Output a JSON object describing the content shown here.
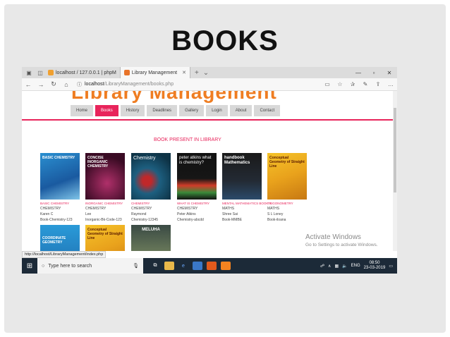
{
  "slide": {
    "title": "BOOKS"
  },
  "browser": {
    "tabs": [
      {
        "label": "localhost / 127.0.0.1 | phpM",
        "active": false
      },
      {
        "label": "Library Management",
        "active": true
      }
    ],
    "address": {
      "host": "localhost",
      "path": "/LibraryManagement/books.php"
    }
  },
  "site": {
    "banner": "Library Management",
    "menu": [
      "Home",
      "Books",
      "History",
      "Deadlines",
      "Gallery",
      "Login",
      "About",
      "Contact"
    ],
    "active_menu": "Books",
    "heading": "BOOK PRESENT IN LIBRARY"
  },
  "books": [
    {
      "cover": "BASIC CHEMISTRY",
      "tag": "BASIC CHEMISTRY",
      "subject": "CHEMISTRY",
      "author": "Karen C",
      "code": "Book-Chemistry-123"
    },
    {
      "cover": "CONCISE INORGANIC CHEMISTRY",
      "tag": "INORGANIC CHEMISTRY",
      "subject": "CHEMISTRY",
      "author": "Lee",
      "code": "Inorganic-Bk-Code-123"
    },
    {
      "cover": "Chemistry",
      "tag": "CHEMISTRY",
      "subject": "CHEMISTRY",
      "author": "Raymond",
      "code": "Chemistry-12345"
    },
    {
      "cover": "peter atkins what is chemistry?",
      "tag": "WHAT IS CHEMISTRY",
      "subject": "CHEMISTRY",
      "author": "Peter Atkins",
      "code": "Chemistry-abcdd"
    },
    {
      "cover": "handbook Mathematics",
      "tag": "MENTAL MATHEMATICS BOOK II",
      "subject": "MATHS",
      "author": "Shree Sai",
      "code": "Book-MMBE"
    },
    {
      "cover": "Conceptual Geometry of Straight Line",
      "tag": "TRIGONOMETRY",
      "subject": "MATHS",
      "author": "S L Loney",
      "code": "Book-iloana"
    },
    {
      "cover": "COORDINATE GEOMETRY",
      "tag": "",
      "subject": "",
      "author": "",
      "code": ""
    },
    {
      "cover": "Conceptual Geometry of Straight Line",
      "tag": "",
      "subject": "",
      "author": "",
      "code": ""
    },
    {
      "cover": "MELUHA",
      "tag": "",
      "subject": "",
      "author": "",
      "code": ""
    }
  ],
  "activation": {
    "title": "Activate Windows",
    "subtitle": "Go to Settings to activate Windows."
  },
  "status_url": "http://localhost/LibraryManagement/index.php",
  "taskbar": {
    "search_placeholder": "Type here to search",
    "language": "ENG",
    "time": "08:50",
    "date": "23-03-2019"
  },
  "colors": {
    "accent": "#e8245b",
    "banner": "#ef7d22",
    "taskbar": "#1c2a38"
  }
}
